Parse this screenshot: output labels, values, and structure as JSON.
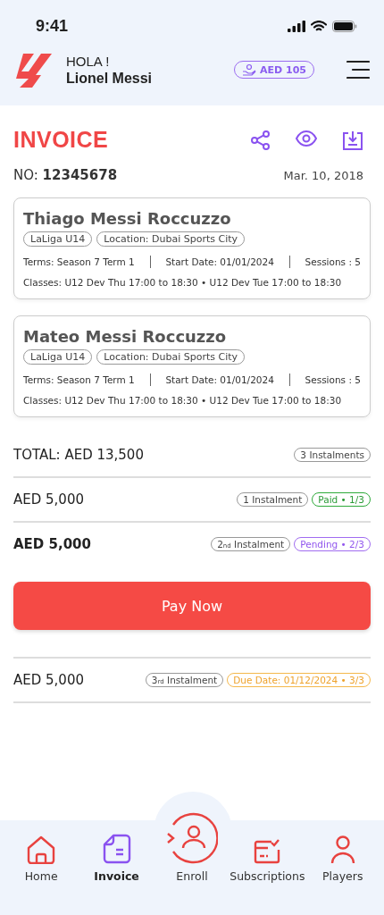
{
  "status_bar": {
    "time": "9:41"
  },
  "header": {
    "greeting": "HOLA !",
    "user_name": "Lionel Messi",
    "wallet": "AED 105"
  },
  "invoice": {
    "title": "INVOICE",
    "number_label": "NO:",
    "number": "12345678",
    "date": "Mar. 10, 2018"
  },
  "players": [
    {
      "name": "Thiago Messi Roccuzzo",
      "tags": [
        "LaLiga U14",
        "Location: Dubai Sports City"
      ],
      "terms": "Terms: Season 7 Term 1",
      "start_date": "Start Date: 01/01/2024",
      "sessions": "Sessions : 5",
      "classes": "Classes: U12 Dev Thu 17:00 to 18:30 • U12 Dev Tue 17:00 to 18:30"
    },
    {
      "name": "Mateo Messi Roccuzzo",
      "tags": [
        "LaLiga U14",
        "Location: Dubai Sports City"
      ],
      "terms": "Terms: Season 7 Term 1",
      "start_date": "Start Date: 01/01/2024",
      "sessions": "Sessions : 5",
      "classes": "Classes: U12 Dev Thu 17:00 to 18:30 • U12 Dev Tue 17:00 to 18:30"
    }
  ],
  "total": {
    "label": "TOTAL: AED  13,500",
    "instalments": "3 Instalments"
  },
  "instalments": [
    {
      "amount": "AED  5,000",
      "current": false,
      "label": "1 Instalment",
      "status": {
        "kind": "paid",
        "text": "Paid • 1/3"
      }
    },
    {
      "amount": "AED  5,000",
      "current": true,
      "label": "2$_{nd}$ Instalment",
      "status": {
        "kind": "pending",
        "text": "Pending • 2/3"
      },
      "action": "Pay Now"
    },
    {
      "amount": "AED  5,000",
      "current": false,
      "label": "3$_{rd}$ Instalment",
      "status": {
        "kind": "due",
        "text": "Due Date: 01/12/2024 • 3/3"
      }
    }
  ],
  "nav": [
    {
      "kind": "home",
      "label": "Home",
      "selected": false
    },
    {
      "kind": "invoice",
      "label": "Invoice",
      "selected": true
    },
    {
      "kind": "enroll",
      "label": "Enroll",
      "selected": false
    },
    {
      "kind": "subscriptions",
      "label": "Subscriptions",
      "selected": false
    },
    {
      "kind": "players",
      "label": "Players",
      "selected": false
    }
  ]
}
